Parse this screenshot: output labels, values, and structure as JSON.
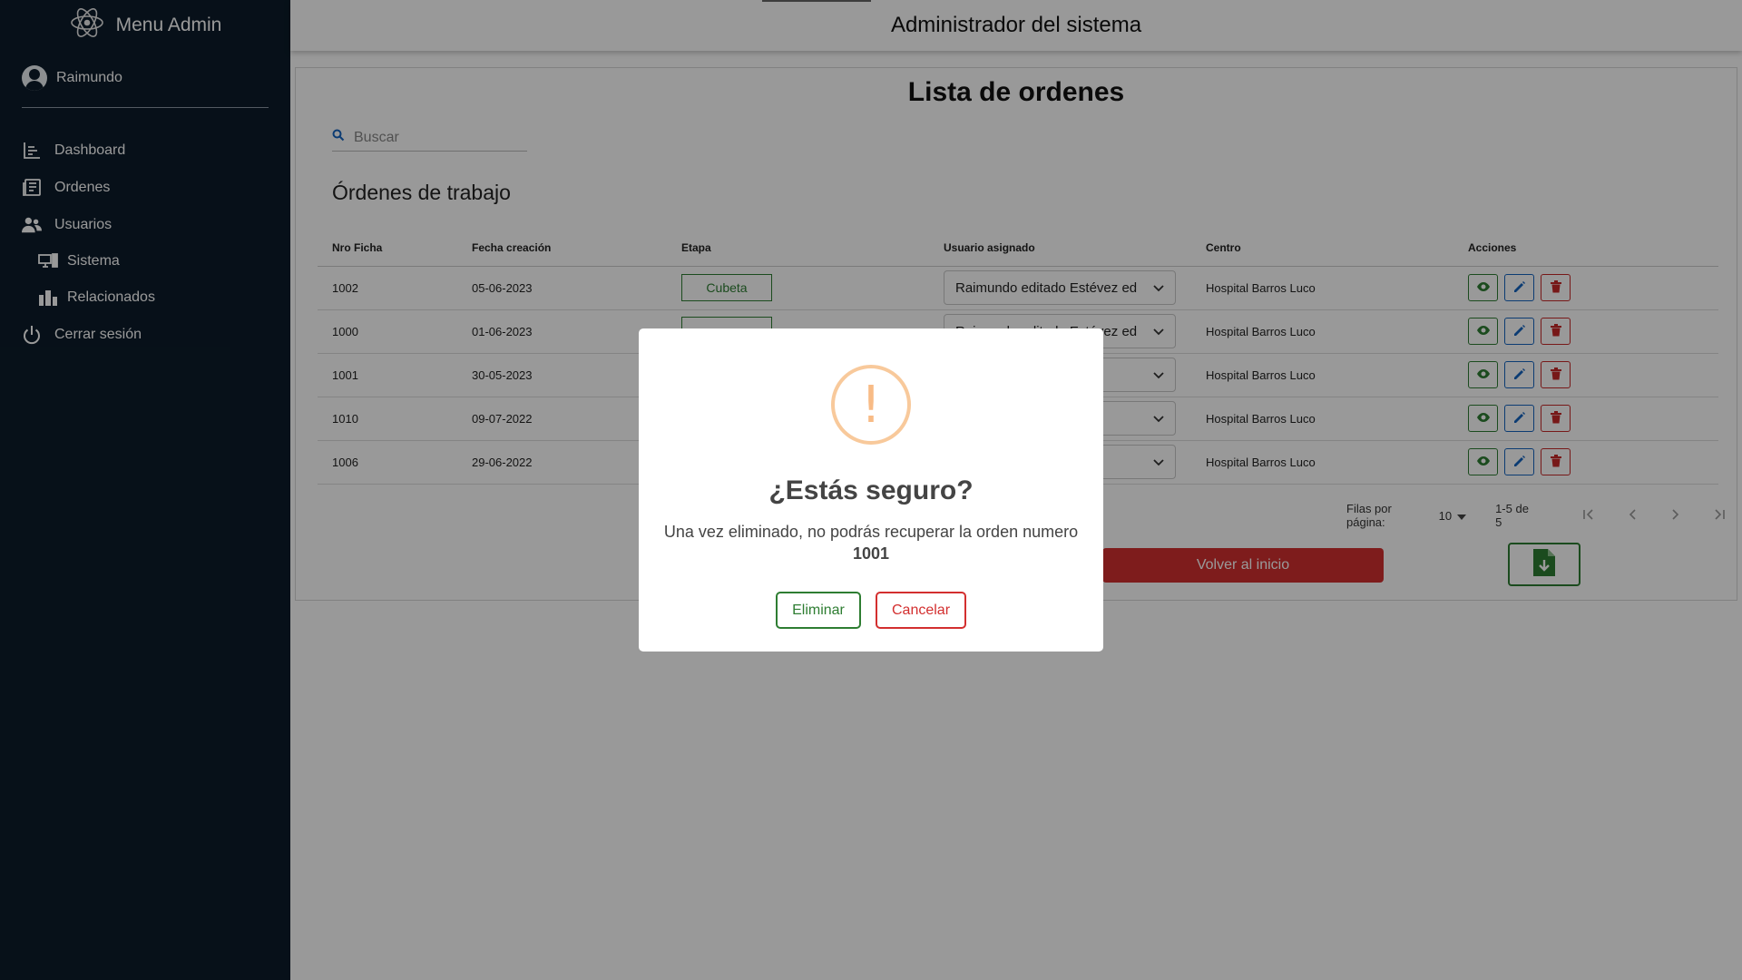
{
  "sidebar": {
    "brand": "Menu Admin",
    "user": "Raimundo",
    "items": [
      {
        "label": "Dashboard",
        "icon": "dashboard-icon"
      },
      {
        "label": "Ordenes",
        "icon": "orders-icon"
      },
      {
        "label": "Usuarios",
        "icon": "users-icon"
      },
      {
        "label": "Sistema",
        "icon": "system-icon"
      },
      {
        "label": "Relacionados",
        "icon": "related-icon"
      },
      {
        "label": "Cerrar sesión",
        "icon": "power-icon"
      }
    ]
  },
  "header": {
    "title": "Administrador del sistema"
  },
  "main": {
    "title": "Lista de ordenes",
    "search_placeholder": "Buscar",
    "section_title": "Órdenes de trabajo",
    "columns": [
      "Nro Ficha",
      "Fecha creación",
      "Etapa",
      "Usuario asignado",
      "Centro",
      "Acciones"
    ],
    "rows": [
      {
        "id": "1002",
        "date": "05-06-2023",
        "stage": "Cubeta",
        "user": "Raimundo editado Estévez ed",
        "center": "Hospital Barros Luco"
      },
      {
        "id": "1000",
        "date": "01-06-2023",
        "stage": "",
        "user": "Raimundo editado Estévez ed",
        "center": "Hospital Barros Luco"
      },
      {
        "id": "1001",
        "date": "30-05-2023",
        "stage": "",
        "user": "",
        "center": "Hospital Barros Luco"
      },
      {
        "id": "1010",
        "date": "09-07-2022",
        "stage": "",
        "user": "",
        "center": "Hospital Barros Luco"
      },
      {
        "id": "1006",
        "date": "29-06-2022",
        "stage": "",
        "user": "",
        "center": "Hospital Barros Luco"
      }
    ],
    "pagination": {
      "rows_label": "Filas por página:",
      "rows_value": "10",
      "range": "1-5 de 5"
    },
    "home_button": "Volver al inicio"
  },
  "modal": {
    "title": "¿Estás seguro?",
    "text": "Una vez eliminado, no podrás recuperar la orden numero",
    "number": "1001",
    "confirm": "Eliminar",
    "cancel": "Cancelar"
  },
  "colors": {
    "sidebar_bg": "#0c1c2a",
    "success": "#2e7d32",
    "primary": "#1565c0",
    "danger": "#d32f2f",
    "warning": "#f8bb86"
  }
}
